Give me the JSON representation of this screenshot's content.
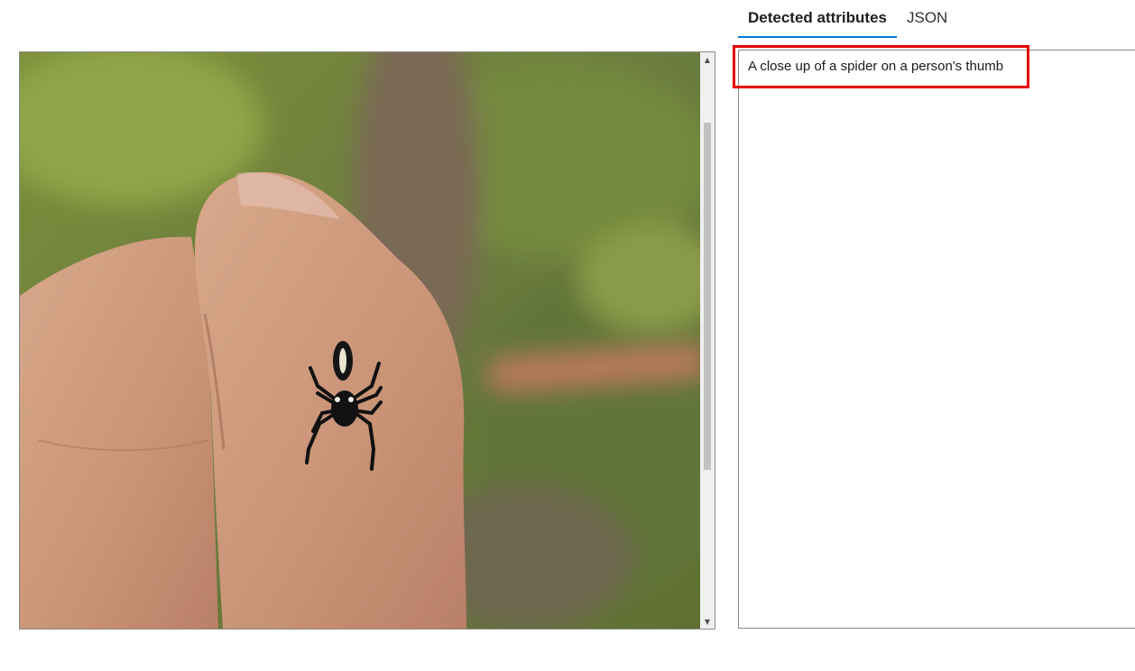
{
  "tabs": [
    {
      "label": "Detected attributes",
      "active": true
    },
    {
      "label": "JSON",
      "active": false
    }
  ],
  "result": {
    "caption": "A close up of a spider on a person's thumb"
  },
  "scrollbar": {
    "up_glyph": "▲",
    "down_glyph": "▼"
  },
  "colors": {
    "highlight": "#e60000",
    "tab_underline": "#0078d4"
  }
}
